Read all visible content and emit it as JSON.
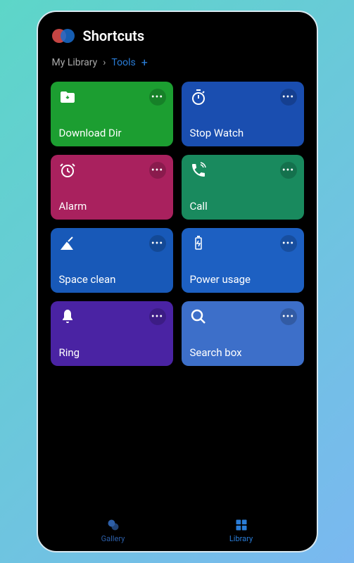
{
  "app": {
    "title": "Shortcuts"
  },
  "breadcrumb": {
    "root": "My Library",
    "current": "Tools"
  },
  "cards": [
    {
      "label": "Download Dir",
      "icon": "download-folder",
      "color": "bg-green"
    },
    {
      "label": "Stop Watch",
      "icon": "stopwatch",
      "color": "bg-blue-dark"
    },
    {
      "label": "Alarm",
      "icon": "alarm-clock",
      "color": "bg-magenta"
    },
    {
      "label": "Call",
      "icon": "phone",
      "color": "bg-teal"
    },
    {
      "label": "Space clean",
      "icon": "broom",
      "color": "bg-blue-med"
    },
    {
      "label": "Power usage",
      "icon": "battery",
      "color": "bg-blue-med2"
    },
    {
      "label": "Ring",
      "icon": "bell",
      "color": "bg-purple"
    },
    {
      "label": "Search box",
      "icon": "search",
      "color": "bg-blue-light"
    }
  ],
  "nav": {
    "gallery": "Gallery",
    "library": "Library"
  }
}
